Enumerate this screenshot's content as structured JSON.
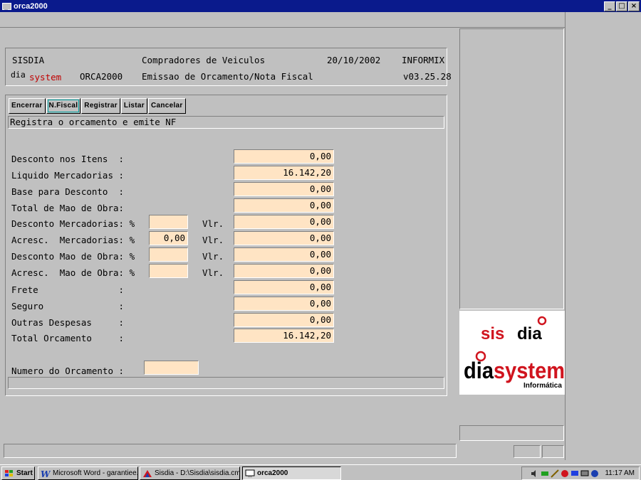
{
  "window": {
    "title": "orca2000",
    "buttons": [
      "_",
      "□",
      "×"
    ]
  },
  "header": {
    "line1": {
      "company": "SISDIA",
      "subtitle": "Compradores de Veiculos",
      "date": "20/10/2002",
      "db": "INFORMIX"
    },
    "line2": {
      "brand_prefix": "dia",
      "brand_suffix": "system",
      "program": "ORCA2000",
      "description": "Emissao de Orcamento/Nota Fiscal",
      "version": "v03.25.28"
    }
  },
  "toolbar": {
    "items": [
      "Encerrar",
      "N.Fiscal",
      "Registrar",
      "Listar",
      "Cancelar"
    ]
  },
  "status_message": "Registra o orcamento e emite NF",
  "form": {
    "desconto_itens": {
      "label": "Desconto nos Itens  :",
      "value": "0,00"
    },
    "liquido_mercadorias": {
      "label": "Liquido Mercadorias :",
      "value": "16.142,20"
    },
    "base_desconto": {
      "label": "Base para Desconto  :",
      "value": "0,00"
    },
    "total_mao_obra": {
      "label": "Total de Mao de Obra:",
      "value": "0,00"
    },
    "desconto_mercadorias": {
      "label": "Desconto Mercadorias: %",
      "pct": "",
      "vlr_label": "Vlr.",
      "value": "0,00"
    },
    "acresc_mercadorias": {
      "label": "Acresc.  Mercadorias: %",
      "pct": "0,00",
      "vlr_label": "Vlr.",
      "value": "0,00"
    },
    "desconto_mao_obra": {
      "label": "Desconto Mao de Obra: %",
      "pct": "",
      "vlr_label": "Vlr.",
      "value": "0,00"
    },
    "acresc_mao_obra": {
      "label": "Acresc.  Mao de Obra: %",
      "pct": "",
      "vlr_label": "Vlr.",
      "value": "0,00"
    },
    "frete": {
      "label": "Frete               :",
      "value": "0,00"
    },
    "seguro": {
      "label": "Seguro              :",
      "value": "0,00"
    },
    "outras_despesas": {
      "label": "Outras Despesas     :",
      "value": "0,00"
    },
    "total_orcamento": {
      "label": "Total Orcamento     :",
      "value": "16.142,20"
    },
    "numero_orcamento": {
      "label": "Numero do Orcamento :",
      "value": ""
    }
  },
  "logo": {
    "top_a": "sis",
    "top_b": "dia",
    "bottom_a": "dia",
    "bottom_b": "system",
    "bottom_c": "Informática"
  },
  "taskbar": {
    "start": "Start",
    "tasks": [
      "Microsoft Word - garantiee...",
      "Sisdia - D:\\Sisdia\\sisdia.cmd",
      "orca2000"
    ],
    "clock": "11:17 AM"
  },
  "colors": {
    "titlebar": "#0a1a8c",
    "field_bg": "#ffe4c4",
    "brand_red": "#d0141e",
    "window_bg": "#c0c0c0"
  }
}
